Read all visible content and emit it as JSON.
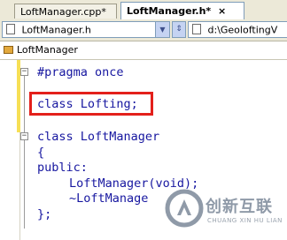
{
  "tabs": [
    {
      "label": "LoftManager.cpp*"
    },
    {
      "label": "LoftManager.h*",
      "close": "×"
    }
  ],
  "navbar": {
    "file_combo_value": "LoftManager.h",
    "path_combo_value": "d:\\GeoloftingV"
  },
  "classbar": {
    "value": "LoftManager"
  },
  "editor": {
    "lines": [
      "#pragma once",
      "class Lofting;",
      "class LoftManager",
      "{",
      "public:",
      "LoftManager(void);",
      "~LoftManage"
    ],
    "truncated_line": "};"
  },
  "watermark": {
    "brand_cn": "创新互联",
    "brand_en": "CHUANG XIN HU LIAN"
  },
  "colors": {
    "keyword": "#1717a0",
    "highlight_border": "#e3201b",
    "change_marker": "#f6df55"
  }
}
